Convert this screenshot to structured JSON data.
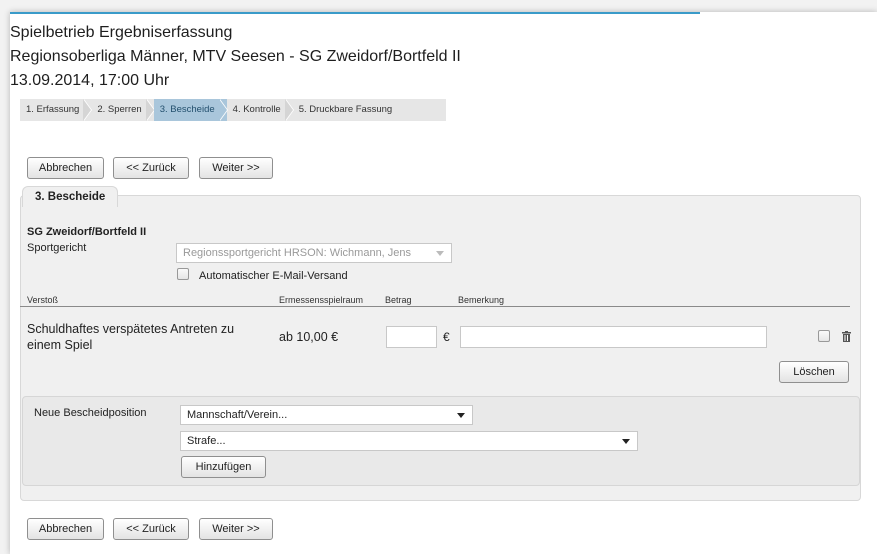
{
  "header": {
    "line1": "Spielbetrieb Ergebniserfassung",
    "line2": "Regionsoberliga Männer, MTV Seesen - SG Zweidorf/Bortfeld II",
    "line3": "13.09.2014, 17:00 Uhr"
  },
  "steps": [
    {
      "label": "1. Erfassung",
      "active": false
    },
    {
      "label": "2. Sperren",
      "active": false
    },
    {
      "label": "3. Bescheide",
      "active": true
    },
    {
      "label": "4. Kontrolle",
      "active": false
    },
    {
      "label": "5. Druckbare Fassung",
      "active": false
    }
  ],
  "buttons": {
    "cancel": "Abbrechen",
    "back": "<< Zurück",
    "next": "Weiter >>",
    "delete": "Löschen",
    "add": "Hinzufügen"
  },
  "section": {
    "tab": "3. Bescheide",
    "team": "SG Zweidorf/Bortfeld II",
    "court_label": "Sportgericht",
    "court_value": "Regionssportgericht HRSON: Wichmann, Jens",
    "auto_email_label": "Automatischer E-Mail-Versand"
  },
  "table": {
    "headers": {
      "violation": "Verstoß",
      "discretion": "Ermessensspielraum",
      "amount": "Betrag",
      "remark": "Bemerkung"
    },
    "rows": [
      {
        "violation_line1": "Schuldhaftes verspätetes Antreten zu",
        "violation_line2": "einem Spiel",
        "discretion": "ab 10,00 €",
        "amount": "",
        "currency": "€",
        "remark": ""
      }
    ]
  },
  "new_position": {
    "label": "Neue Bescheidposition",
    "team_select": "Mannschaft/Verein...",
    "penalty_select": "Strafe..."
  }
}
